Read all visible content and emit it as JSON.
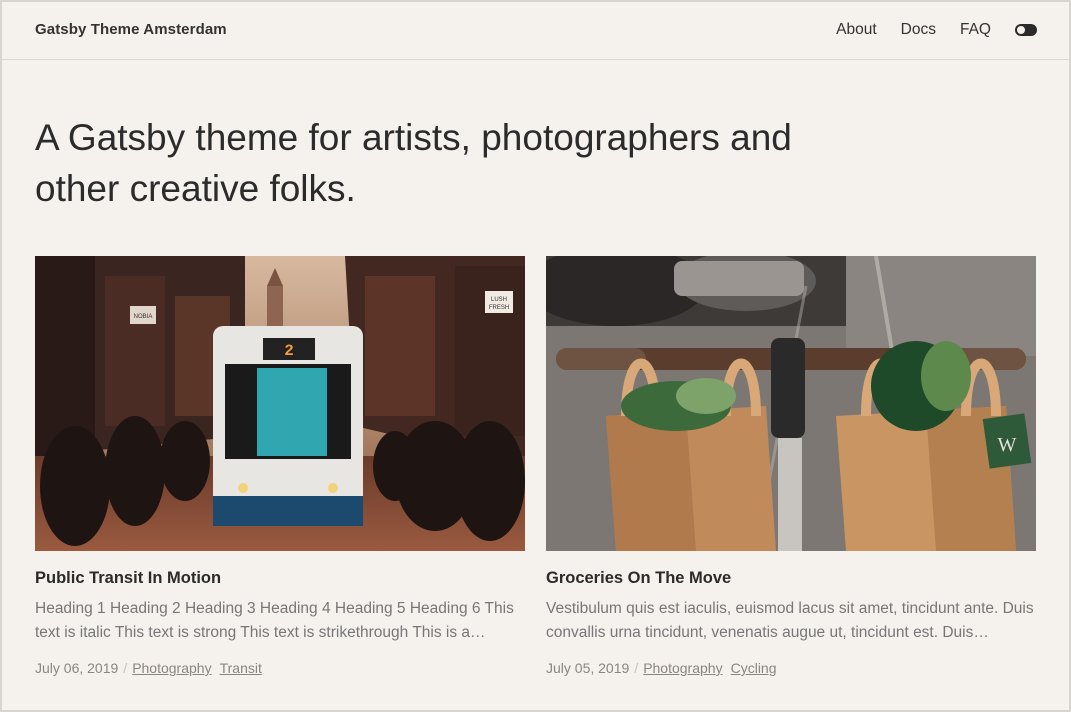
{
  "header": {
    "site_title": "Gatsby Theme Amsterdam",
    "nav": [
      "About",
      "Docs",
      "FAQ"
    ]
  },
  "hero": {
    "tagline": "A Gatsby theme for artists, photographers and other creative folks."
  },
  "posts": [
    {
      "title": "Public Transit In Motion",
      "excerpt": "Heading 1 Heading 2 Heading 3 Heading 4 Heading 5 Heading 6 This text is italic This text is strong This text is strikethrough This is a…",
      "date": "July 06, 2019",
      "tags": [
        "Photography",
        "Transit"
      ],
      "image_text": {
        "tram_number": "2",
        "sign_1": "LUSH FRESH",
        "sign_2": "NOBIA"
      }
    },
    {
      "title": "Groceries On The Move",
      "excerpt": "Vestibulum quis est iaculis, euismod lacus sit amet, tincidunt ante. Duis convallis urna tincidunt, venenatis augue ut, tincidunt est. Duis…",
      "date": "July 05, 2019",
      "tags": [
        "Photography",
        "Cycling"
      ],
      "image_text": {
        "bag_logo": "W"
      }
    }
  ],
  "colors": {
    "background": "#f5f1ed",
    "text": "#2b2b2b",
    "muted": "#8a8580"
  }
}
